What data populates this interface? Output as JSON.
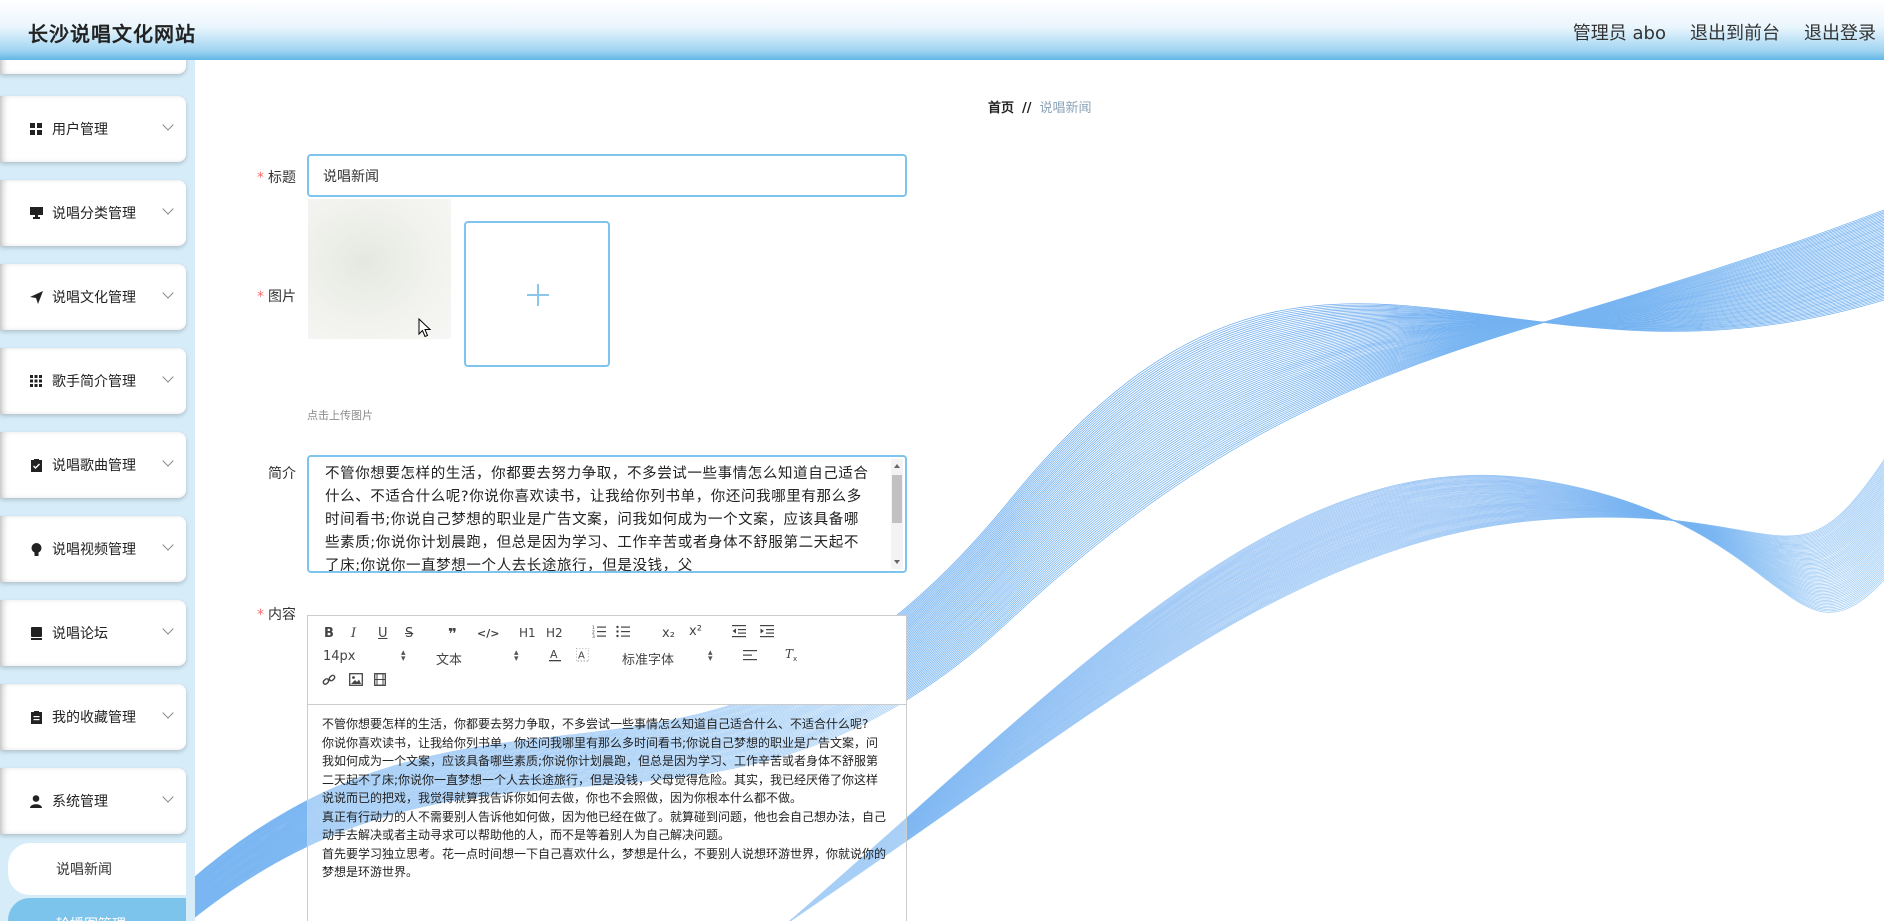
{
  "header": {
    "site_title": "长沙说唱文化网站",
    "admin_label": "管理员 abo",
    "back_to_front": "退出到前台",
    "logout": "退出登录"
  },
  "sidebar": {
    "items": [
      {
        "label": "用户管理",
        "icon": "grid-icon"
      },
      {
        "label": "说唱分类管理",
        "icon": "monitor-icon"
      },
      {
        "label": "说唱文化管理",
        "icon": "send-icon"
      },
      {
        "label": "歌手简介管理",
        "icon": "apps-icon"
      },
      {
        "label": "说唱歌曲管理",
        "icon": "clipboard-check-icon"
      },
      {
        "label": "说唱视频管理",
        "icon": "bulb-icon"
      },
      {
        "label": "说唱论坛",
        "icon": "book-icon"
      },
      {
        "label": "我的收藏管理",
        "icon": "document-icon"
      },
      {
        "label": "系统管理",
        "icon": "user-icon"
      }
    ],
    "sub_items": [
      {
        "label": "说唱新闻"
      },
      {
        "label": "轮播图管理"
      }
    ]
  },
  "breadcrumb": {
    "home": "首页",
    "separator": "//",
    "current": "说唱新闻"
  },
  "form": {
    "title_label": "标题",
    "title_value": "说唱新闻",
    "image_label": "图片",
    "upload_hint": "点击上传图片",
    "intro_label": "简介",
    "intro_value": "不管你想要怎样的生活，你都要去努力争取，不多尝试一些事情怎么知道自己适合什么、不适合什么呢?你说你喜欢读书，让我给你列书单，你还问我哪里有那么多时间看书;你说自己梦想的职业是广告文案，问我如何成为一个文案，应该具备哪些素质;你说你计划晨跑，但总是因为学习、工作辛苦或者身体不舒服第二天起不了床;你说你一直梦想一个人去长途旅行，但是没钱，父",
    "content_label": "内容"
  },
  "editor": {
    "font_size": "14px",
    "block_format": "文本",
    "font_family": "标准字体",
    "toolbar_row1": [
      "B",
      "I",
      "U",
      "S",
      "❞",
      "</>",
      "H1",
      "H2",
      "ol",
      "ul",
      "x₂",
      "x²",
      "outdent",
      "indent"
    ],
    "content": [
      "不管你想要怎样的生活，你都要去努力争取，不多尝试一些事情怎么知道自己适合什么、不适合什么呢?",
      "你说你喜欢读书，让我给你列书单，你还问我哪里有那么多时间看书;你说自己梦想的职业是广告文案，问我如何成为一个文案，应该具备哪些素质;你说你计划晨跑，但总是因为学习、工作辛苦或者身体不舒服第二天起不了床;你说你一直梦想一个人去长途旅行，但是没钱，父母觉得危险。其实，我已经厌倦了你这样说说而已的把戏，我觉得就算我告诉你如何去做，你也不会照做，因为你根本什么都不做。",
      "真正有行动力的人不需要别人告诉他如何做，因为他已经在做了。就算碰到问题，他也会自己想办法，自己动手去解决或者主动寻求可以帮助他的人，而不是等着别人为自己解决问题。",
      "首先要学习独立思考。花一点时间想一下自己喜欢什么，梦想是什么，不要别人说想环游世界，你就说你的梦想是环游世界。"
    ]
  },
  "colors": {
    "accent": "#7ec4ec",
    "sidebar_bg": "#d6ecf8",
    "active_sub": "#7cc4ec",
    "required": "#f56c6c"
  }
}
